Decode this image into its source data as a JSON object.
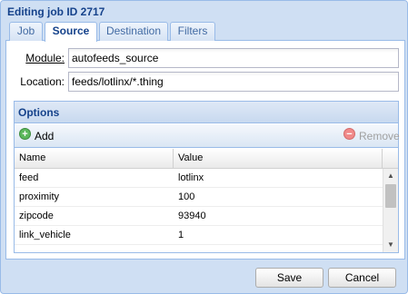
{
  "window": {
    "title": "Editing job ID 2717"
  },
  "tabs": [
    {
      "label": "Job"
    },
    {
      "label": "Source",
      "active": true
    },
    {
      "label": "Destination"
    },
    {
      "label": "Filters"
    }
  ],
  "form": {
    "module_label": "Module:",
    "module_value": "autofeeds_source",
    "location_label": "Location:",
    "location_value": "feeds/lotlinx/*.thing"
  },
  "options": {
    "header": "Options",
    "add_label": "Add",
    "remove_label": "Remove",
    "add_icon": "plus-circle-icon",
    "remove_icon": "minus-circle-icon",
    "columns": [
      "Name",
      "Value"
    ],
    "rows": [
      {
        "name": "feed",
        "value": "lotlinx"
      },
      {
        "name": "proximity",
        "value": "100"
      },
      {
        "name": "zipcode",
        "value": "93940"
      },
      {
        "name": "link_vehicle",
        "value": "1"
      }
    ]
  },
  "buttons": {
    "save": "Save",
    "cancel": "Cancel"
  },
  "colors": {
    "title": "#15428b",
    "border": "#99bbe8",
    "add": "#4caf50",
    "remove": "#e57373"
  }
}
